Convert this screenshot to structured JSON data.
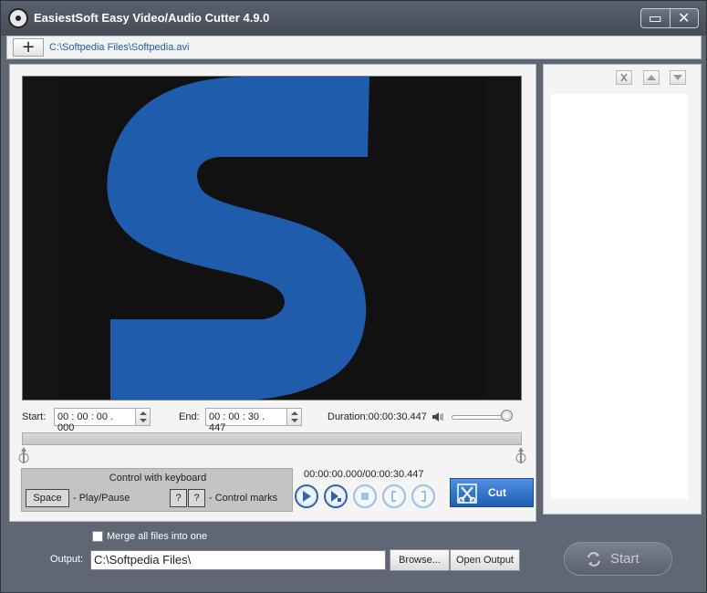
{
  "window": {
    "title": "EasiestSoft Easy Video/Audio Cutter 4.9.0",
    "minimize_glyph": "▭",
    "close_glyph": "✕"
  },
  "filebar": {
    "add_glyph": "+",
    "file_path": "C:\\Softpedia Files\\Softpedia.avi"
  },
  "times": {
    "start_label": "Start:",
    "start_value": "00 : 00 : 00 . 000",
    "end_label": "End:",
    "end_value": "00 : 00 : 30 . 447",
    "duration_text": "Duration:00:00:30.447",
    "volume_level": 1.0
  },
  "keyboard": {
    "title": "Control with keyboard",
    "space_key": "Space",
    "space_desc": "- Play/Pause",
    "mark_key_1": "?",
    "mark_key_2": "?",
    "mark_desc": "- Control marks"
  },
  "playback": {
    "position_text": "00:00:00.000/00:00:30.447"
  },
  "cut": {
    "label": "Cut"
  },
  "output": {
    "merge_label": "Merge all files into one",
    "label": "Output:",
    "path": "C:\\Softpedia Files\\",
    "browse_label": "Browse...",
    "open_label": "Open Output",
    "start_label": "Start"
  },
  "colors": {
    "accent": "#2c66b3",
    "video_logo": "#1f5cac",
    "frame": "#5f6674"
  }
}
